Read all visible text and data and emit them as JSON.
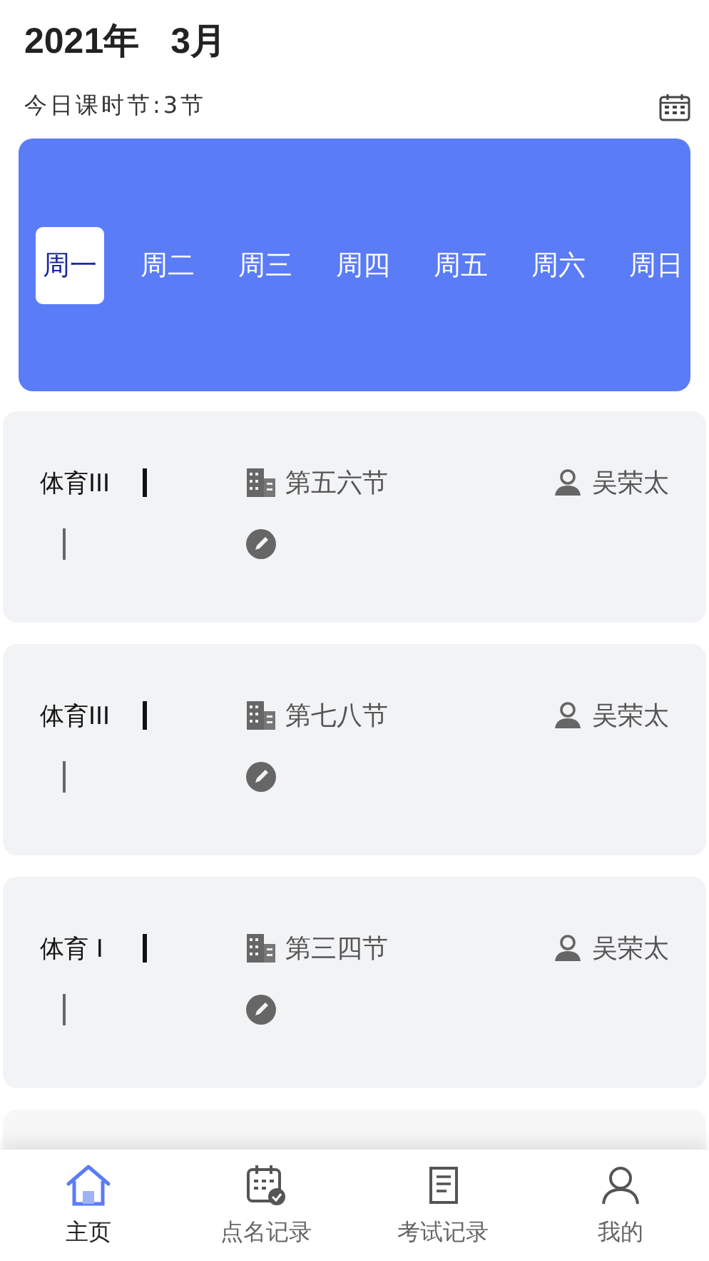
{
  "header": {
    "year": "2021年",
    "month": "3月"
  },
  "summary": "今日课时节:3节",
  "days": [
    {
      "label": "周一",
      "selected": true
    },
    {
      "label": "周二",
      "selected": false
    },
    {
      "label": "周三",
      "selected": false
    },
    {
      "label": "周四",
      "selected": false
    },
    {
      "label": "周五",
      "selected": false
    },
    {
      "label": "周六",
      "selected": false
    },
    {
      "label": "周日",
      "selected": false
    }
  ],
  "courses": [
    {
      "name": "体育III",
      "period": "第五六节",
      "teacher": "吴荣太"
    },
    {
      "name": "体育III",
      "period": "第七八节",
      "teacher": "吴荣太"
    },
    {
      "name": "体育 I",
      "period": "第三四节",
      "teacher": "吴荣太"
    }
  ],
  "tab_bar": [
    {
      "kind": "home",
      "label": "主页",
      "selected": true
    },
    {
      "kind": "attendance",
      "label": "点名记录",
      "selected": false
    },
    {
      "kind": "exam",
      "label": "考试记录",
      "selected": false
    },
    {
      "kind": "profile",
      "label": "我的",
      "selected": false
    }
  ]
}
